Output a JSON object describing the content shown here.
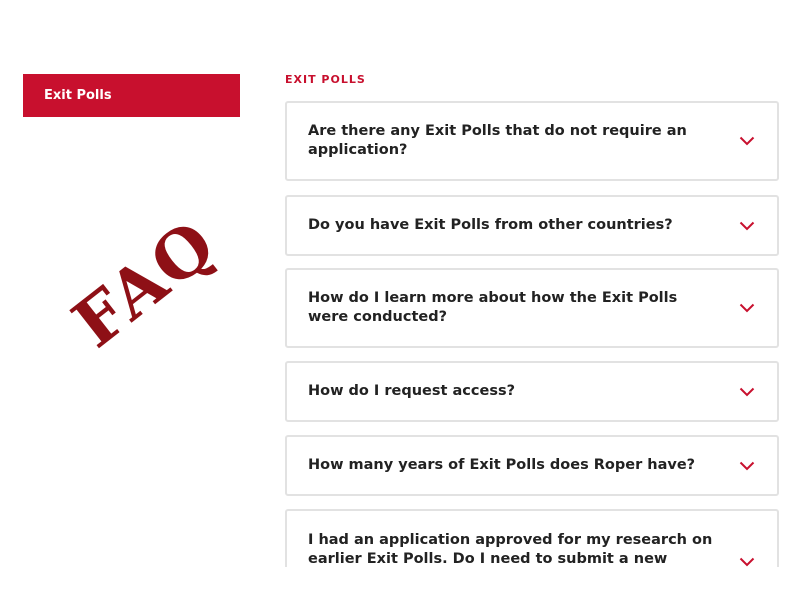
{
  "sidebar": {
    "active_item": "Exit Polls"
  },
  "watermark": "FAQ",
  "section": {
    "heading": "EXIT POLLS"
  },
  "faq": [
    {
      "question": "Are there any Exit Polls that do not require an application?"
    },
    {
      "question": "Do you have Exit Polls from other countries?"
    },
    {
      "question": "How do I learn more about how the Exit Polls were conducted?"
    },
    {
      "question": "How do I request access?"
    },
    {
      "question": "How many years of Exit Polls does Roper have?"
    },
    {
      "question": "I had an application approved for my research on earlier Exit Polls. Do I need to submit a new"
    }
  ],
  "colors": {
    "accent": "#c8102e",
    "watermark": "#8e1016",
    "border": "#e2e2e2"
  }
}
